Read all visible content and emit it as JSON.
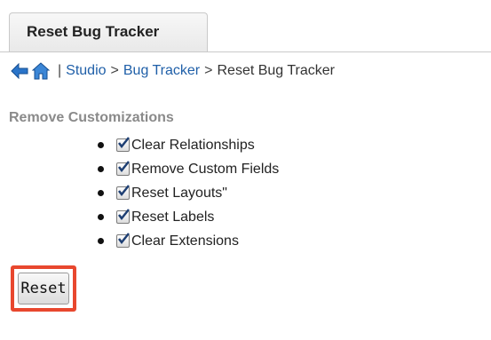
{
  "tab": {
    "label": "Reset Bug Tracker"
  },
  "breadcrumb": {
    "back_icon": "back-arrow-icon",
    "home_icon": "home-icon",
    "separator": "|",
    "items": [
      {
        "label": "Studio"
      },
      {
        "label": "Bug Tracker"
      }
    ],
    "arrow": ">",
    "current": "Reset Bug Tracker"
  },
  "section": {
    "title": "Remove Customizations",
    "options": [
      {
        "label": "Clear Relationships",
        "checked": true
      },
      {
        "label": "Remove Custom Fields",
        "checked": true
      },
      {
        "label": "Reset Layouts\"",
        "checked": true
      },
      {
        "label": "Reset Labels",
        "checked": true
      },
      {
        "label": "Clear Extensions",
        "checked": true
      }
    ]
  },
  "actions": {
    "reset_label": "Reset"
  },
  "colors": {
    "link": "#1f5fa8",
    "highlight": "#e8472e",
    "section_title": "#8a8a8a"
  }
}
